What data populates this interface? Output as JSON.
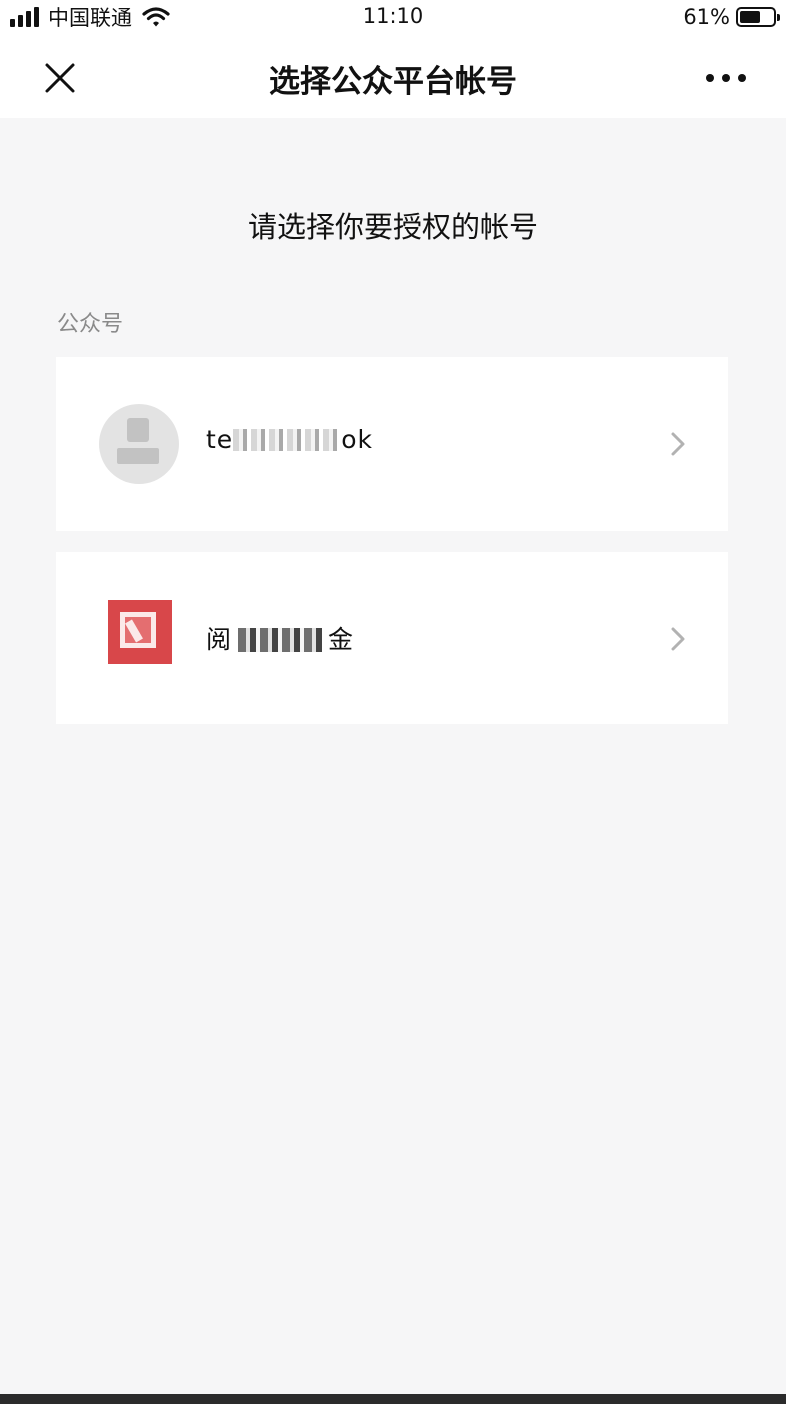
{
  "status_bar": {
    "carrier": "中国联通",
    "time": "11:10",
    "battery_percent": "61%",
    "battery_level": 0.61,
    "icons": [
      "signal-icon",
      "wifi-icon",
      "battery-icon"
    ]
  },
  "nav": {
    "title": "选择公众平台帐号",
    "close_icon": "close-icon",
    "more_icon": "more-icon"
  },
  "prompt": "请选择你要授权的帐号",
  "section_label": "公众号",
  "accounts": [
    {
      "name_prefix": "te",
      "name_suffix": "ok",
      "avatar": "default-avatar-icon"
    },
    {
      "name_prefix": "阅",
      "name_suffix": "金",
      "avatar": "account-logo-icon"
    }
  ],
  "colors": {
    "background": "#f6f6f7",
    "card": "#ffffff",
    "text": "#111111",
    "muted": "#8a8a8a",
    "logo_red": "#d8474a"
  }
}
